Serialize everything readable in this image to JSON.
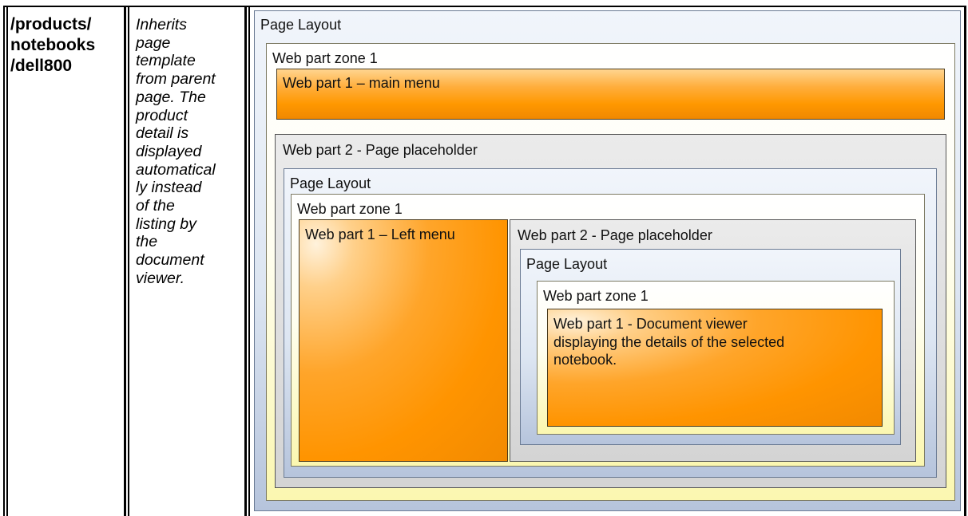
{
  "row": {
    "path": "/products/\nnotebooks\n/dell800",
    "description": "Inherits\npage\ntemplate\nfrom parent\npage. The\nproduct\ndetail is\ndisplayed\nautomatical\nly instead\nof the\nlisting by\nthe\ndocument\nviewer."
  },
  "diagram": {
    "outer_layout": "Page Layout",
    "outer_zone": "Web part zone 1",
    "main_menu": "Web part 1 – main menu",
    "outer_placeholder": "Web part 2 - Page placeholder",
    "mid_layout": "Page Layout",
    "mid_zone": "Web part zone 1",
    "left_menu": "Web part 1 – Left menu",
    "mid_placeholder": "Web part 2 - Page placeholder",
    "inner_layout": "Page Layout",
    "inner_zone": "Web part zone 1",
    "document_viewer": "Web part 1 - Document viewer\ndisplaying the details of the selected\nnotebook."
  }
}
